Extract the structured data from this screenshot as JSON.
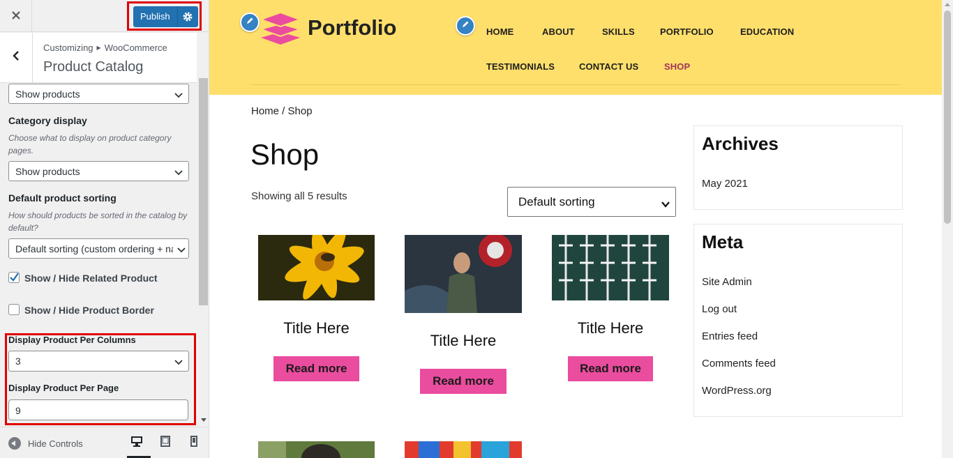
{
  "panel": {
    "close_icon": "close-icon",
    "publish_label": "Publish",
    "breadcrumb": {
      "root": "Customizing",
      "section": "WooCommerce"
    },
    "section_title": "Product Catalog",
    "shop_page_display": {
      "value": "Show products"
    },
    "category_display": {
      "label": "Category display",
      "description": "Choose what to display on product category pages.",
      "value": "Show products"
    },
    "default_sorting": {
      "label": "Default product sorting",
      "description": "How should products be sorted in the catalog by default?",
      "value": "Default sorting (custom ordering + name)"
    },
    "related_product": {
      "label": "Show / Hide Related Product",
      "checked": true
    },
    "product_border": {
      "label": "Show / Hide Product Border",
      "checked": false
    },
    "per_columns": {
      "label": "Display Product Per Columns",
      "value": "3"
    },
    "per_page": {
      "label": "Display Product Per Page",
      "value": "9"
    },
    "footer": {
      "hide_controls": "Hide Controls",
      "active_device": "desktop"
    }
  },
  "site": {
    "logo_text": "Portfolio",
    "accent_color": "#ffdf6b",
    "button_color": "#ea4c9e",
    "nav": {
      "home": "HOME",
      "about": "ABOUT",
      "skills": "SKILLS",
      "portfolio": "PORTFOLIO",
      "education": "EDUCATION",
      "testimonials": "TESTIMONIALS",
      "contact": "CONTACT US",
      "shop": "SHOP"
    },
    "breadcrumb": "Home / Shop",
    "page_title": "Shop",
    "result_count": "Showing all 5 results",
    "sorting": "Default sorting",
    "products": [
      {
        "title": "Title Here",
        "button": "Read more",
        "image": "yellow flower with bee"
      },
      {
        "title": "Title Here",
        "button": "Read more",
        "image": "person in front of graffiti"
      },
      {
        "title": "Title Here",
        "button": "Read more",
        "image": "grid of white pegs on green"
      },
      {
        "image": "person outdoors"
      },
      {
        "image": "colorful paint"
      }
    ],
    "archives": {
      "title": "Archives",
      "items": [
        "May 2021"
      ]
    },
    "meta": {
      "title": "Meta",
      "items": [
        "Site Admin",
        "Log out",
        "Entries feed",
        "Comments feed",
        "WordPress.org"
      ]
    }
  }
}
